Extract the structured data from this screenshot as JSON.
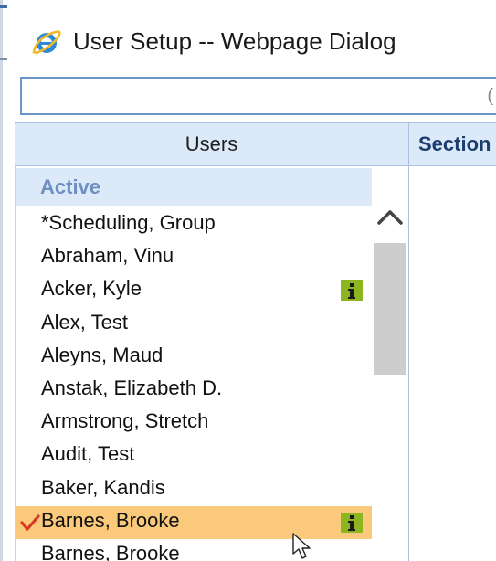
{
  "window": {
    "title": "User Setup -- Webpage Dialog",
    "icon": "internet-explorer-icon"
  },
  "address_bar": {
    "value": ""
  },
  "columns": {
    "users": "Users",
    "section": "Section"
  },
  "user_list": {
    "group_label": "Active",
    "items": [
      {
        "label": "*Scheduling, Group",
        "info": false,
        "selected": false
      },
      {
        "label": "Abraham, Vinu",
        "info": false,
        "selected": false
      },
      {
        "label": "Acker, Kyle",
        "info": true,
        "selected": false
      },
      {
        "label": "Alex, Test",
        "info": false,
        "selected": false
      },
      {
        "label": "Aleyns, Maud",
        "info": false,
        "selected": false
      },
      {
        "label": "Anstak, Elizabeth D.",
        "info": false,
        "selected": false
      },
      {
        "label": "Armstrong, Stretch",
        "info": false,
        "selected": false
      },
      {
        "label": "Audit, Test",
        "info": false,
        "selected": false
      },
      {
        "label": "Baker, Kandis",
        "info": false,
        "selected": false
      },
      {
        "label": "Barnes, Brooke",
        "info": true,
        "selected": true
      },
      {
        "label": "Barnes, Brooke",
        "info": false,
        "selected": false
      }
    ]
  },
  "colors": {
    "header_bg": "#dce9f8",
    "group_label": "#6f8fc2",
    "selected_row": "#fbc97b",
    "info_badge": "#8cb520",
    "check_mark": "#d93a1f"
  },
  "icons": {
    "info": "info-icon",
    "check": "check-icon",
    "scroll_up": "chevron-up-icon",
    "cursor": "mouse-pointer-icon"
  }
}
